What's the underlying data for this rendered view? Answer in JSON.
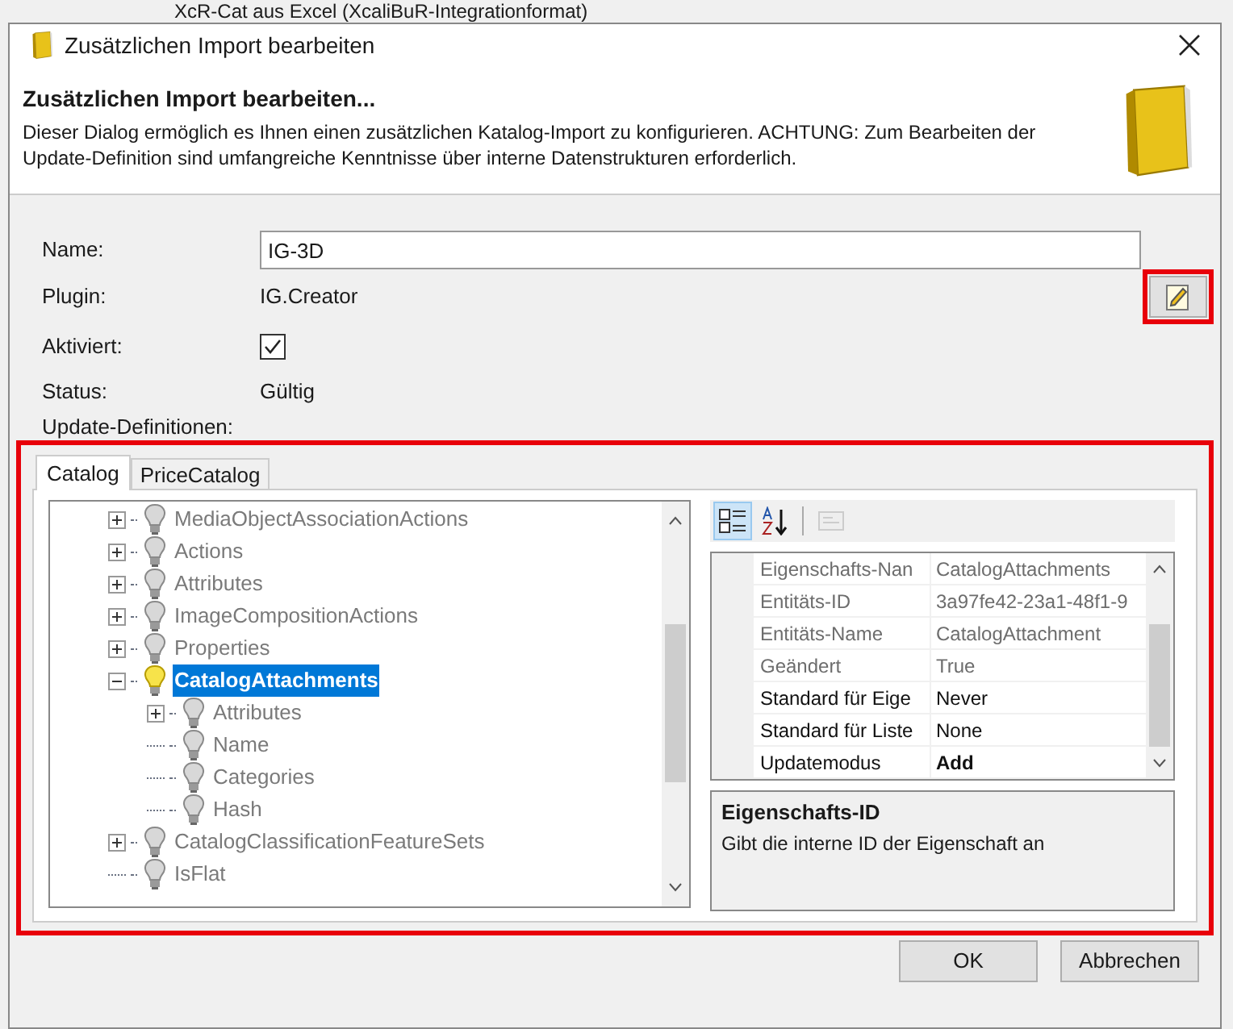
{
  "background_window": {
    "title": "XcR-Cat aus Excel (XcaliBuR-Integrationformat)"
  },
  "window": {
    "title": "Zusätzlichen Import bearbeiten"
  },
  "header": {
    "title": "Zusätzlichen Import bearbeiten...",
    "description": "Dieser Dialog ermöglich es Ihnen einen zusätzlichen Katalog-Import zu konfigurieren. ACHTUNG: Zum Bearbeiten der Update-Definition sind umfangreiche Kenntnisse über interne Datenstrukturen erforderlich."
  },
  "form": {
    "name_label": "Name:",
    "name_value": "IG-3D",
    "plugin_label": "Plugin:",
    "plugin_value": "IG.Creator",
    "enabled_label": "Aktiviert:",
    "enabled_checked": true,
    "status_label": "Status:",
    "status_value": "Gültig",
    "definitions_label": "Update-Definitionen:"
  },
  "tabs": [
    {
      "label": "Catalog",
      "selected": true
    },
    {
      "label": "PriceCatalog",
      "selected": false
    }
  ],
  "tree": [
    {
      "label": "MediaObjectAssociationActions",
      "kind": "collapsed",
      "selected": false
    },
    {
      "label": "Actions",
      "kind": "collapsed",
      "selected": false
    },
    {
      "label": "Attributes",
      "kind": "collapsed",
      "selected": false
    },
    {
      "label": "ImageCompositionActions",
      "kind": "collapsed",
      "selected": false
    },
    {
      "label": "Properties",
      "kind": "collapsed",
      "selected": false
    },
    {
      "label": "CatalogAttachments",
      "kind": "expanded",
      "selected": true,
      "children": [
        {
          "label": "Attributes",
          "kind": "collapsed",
          "selected": false
        },
        {
          "label": "Name",
          "kind": "leaf",
          "selected": false
        },
        {
          "label": "Categories",
          "kind": "leaf",
          "selected": false
        },
        {
          "label": "Hash",
          "kind": "leaf",
          "selected": false
        }
      ]
    },
    {
      "label": "CatalogClassificationFeatureSets",
      "kind": "collapsed",
      "selected": false
    },
    {
      "label": "IsFlat",
      "kind": "leaf",
      "selected": false
    }
  ],
  "property_toolbar": [
    {
      "kind": "categorized",
      "selected": true,
      "disabled": false
    },
    {
      "kind": "alphabetical",
      "selected": false,
      "disabled": false
    },
    {
      "kind": "pages",
      "selected": false,
      "disabled": true
    }
  ],
  "properties": [
    {
      "name": "Eigenschafts-Nan",
      "value": "CatalogAttachments",
      "readonly": true,
      "non_default": false
    },
    {
      "name": "Entitäts-ID",
      "value": "3a97fe42-23a1-48f1-9",
      "readonly": true,
      "non_default": false
    },
    {
      "name": "Entitäts-Name",
      "value": "CatalogAttachment",
      "readonly": true,
      "non_default": false
    },
    {
      "name": "Geändert",
      "value": "True",
      "readonly": true,
      "non_default": false
    },
    {
      "name": "Standard für Eige",
      "value": "Never",
      "readonly": false,
      "non_default": false
    },
    {
      "name": "Standard für Liste",
      "value": "None",
      "readonly": false,
      "non_default": false
    },
    {
      "name": "Updatemodus",
      "value": "Add",
      "readonly": false,
      "non_default": true
    }
  ],
  "property_help": {
    "title": "Eigenschafts-ID",
    "text": "Gibt die interne ID der Eigenschaft an"
  },
  "buttons": [
    "OK",
    "Abbrechen"
  ]
}
